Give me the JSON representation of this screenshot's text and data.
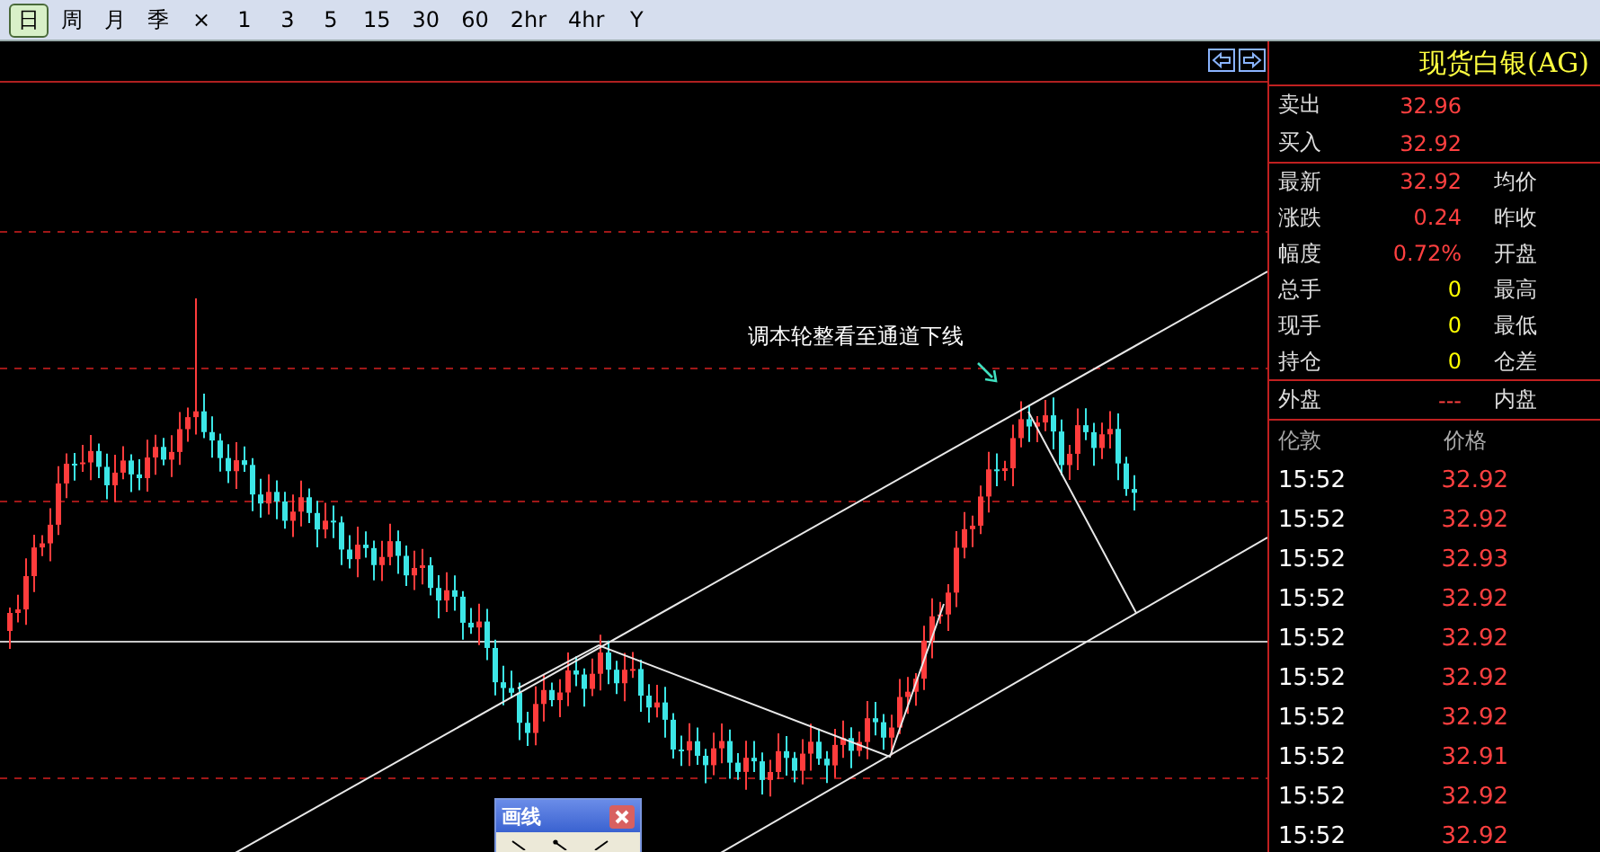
{
  "toolbar": {
    "periods": [
      {
        "label": "日",
        "selected": true
      },
      {
        "label": "周",
        "selected": false
      },
      {
        "label": "月",
        "selected": false
      },
      {
        "label": "季",
        "selected": false
      },
      {
        "label": "×",
        "selected": false
      },
      {
        "label": "1",
        "selected": false
      },
      {
        "label": "3",
        "selected": false
      },
      {
        "label": "5",
        "selected": false
      },
      {
        "label": "15",
        "selected": false
      },
      {
        "label": "30",
        "selected": false
      },
      {
        "label": "60",
        "selected": false
      },
      {
        "label": "2hr",
        "selected": false
      },
      {
        "label": "4hr",
        "selected": false
      },
      {
        "label": "Y",
        "selected": false
      }
    ]
  },
  "chart": {
    "annotation": "调本轮整看至通道下线"
  },
  "drawing_panel": {
    "title": "画线"
  },
  "quote": {
    "title": "现货白银(AG)",
    "bid_ask": [
      {
        "label": "卖出",
        "value": "32.96"
      },
      {
        "label": "买入",
        "value": "32.92"
      }
    ],
    "stats": [
      {
        "label": "最新",
        "value": "32.92",
        "label2": "均价",
        "kind": "price"
      },
      {
        "label": "涨跌",
        "value": "0.24",
        "label2": "昨收",
        "kind": "price"
      },
      {
        "label": "幅度",
        "value": "0.72%",
        "label2": "开盘",
        "kind": "price"
      },
      {
        "label": "总手",
        "value": "0",
        "label2": "最高",
        "kind": "volume"
      },
      {
        "label": "现手",
        "value": "0",
        "label2": "最低",
        "kind": "volume"
      },
      {
        "label": "持仓",
        "value": "0",
        "label2": "仓差",
        "kind": "volume"
      }
    ],
    "outer": {
      "label": "外盘",
      "value": "---",
      "label2": "内盘"
    }
  },
  "ticks": {
    "columns": [
      "伦敦",
      "价格"
    ],
    "rows": [
      {
        "time": "15:52",
        "price": "32.92"
      },
      {
        "time": "15:52",
        "price": "32.92"
      },
      {
        "time": "15:52",
        "price": "32.93"
      },
      {
        "time": "15:52",
        "price": "32.92"
      },
      {
        "time": "15:52",
        "price": "32.92"
      },
      {
        "time": "15:52",
        "price": "32.92"
      },
      {
        "time": "15:52",
        "price": "32.92"
      },
      {
        "time": "15:52",
        "price": "32.91"
      },
      {
        "time": "15:52",
        "price": "32.92"
      },
      {
        "time": "15:52",
        "price": "32.92"
      }
    ]
  }
}
